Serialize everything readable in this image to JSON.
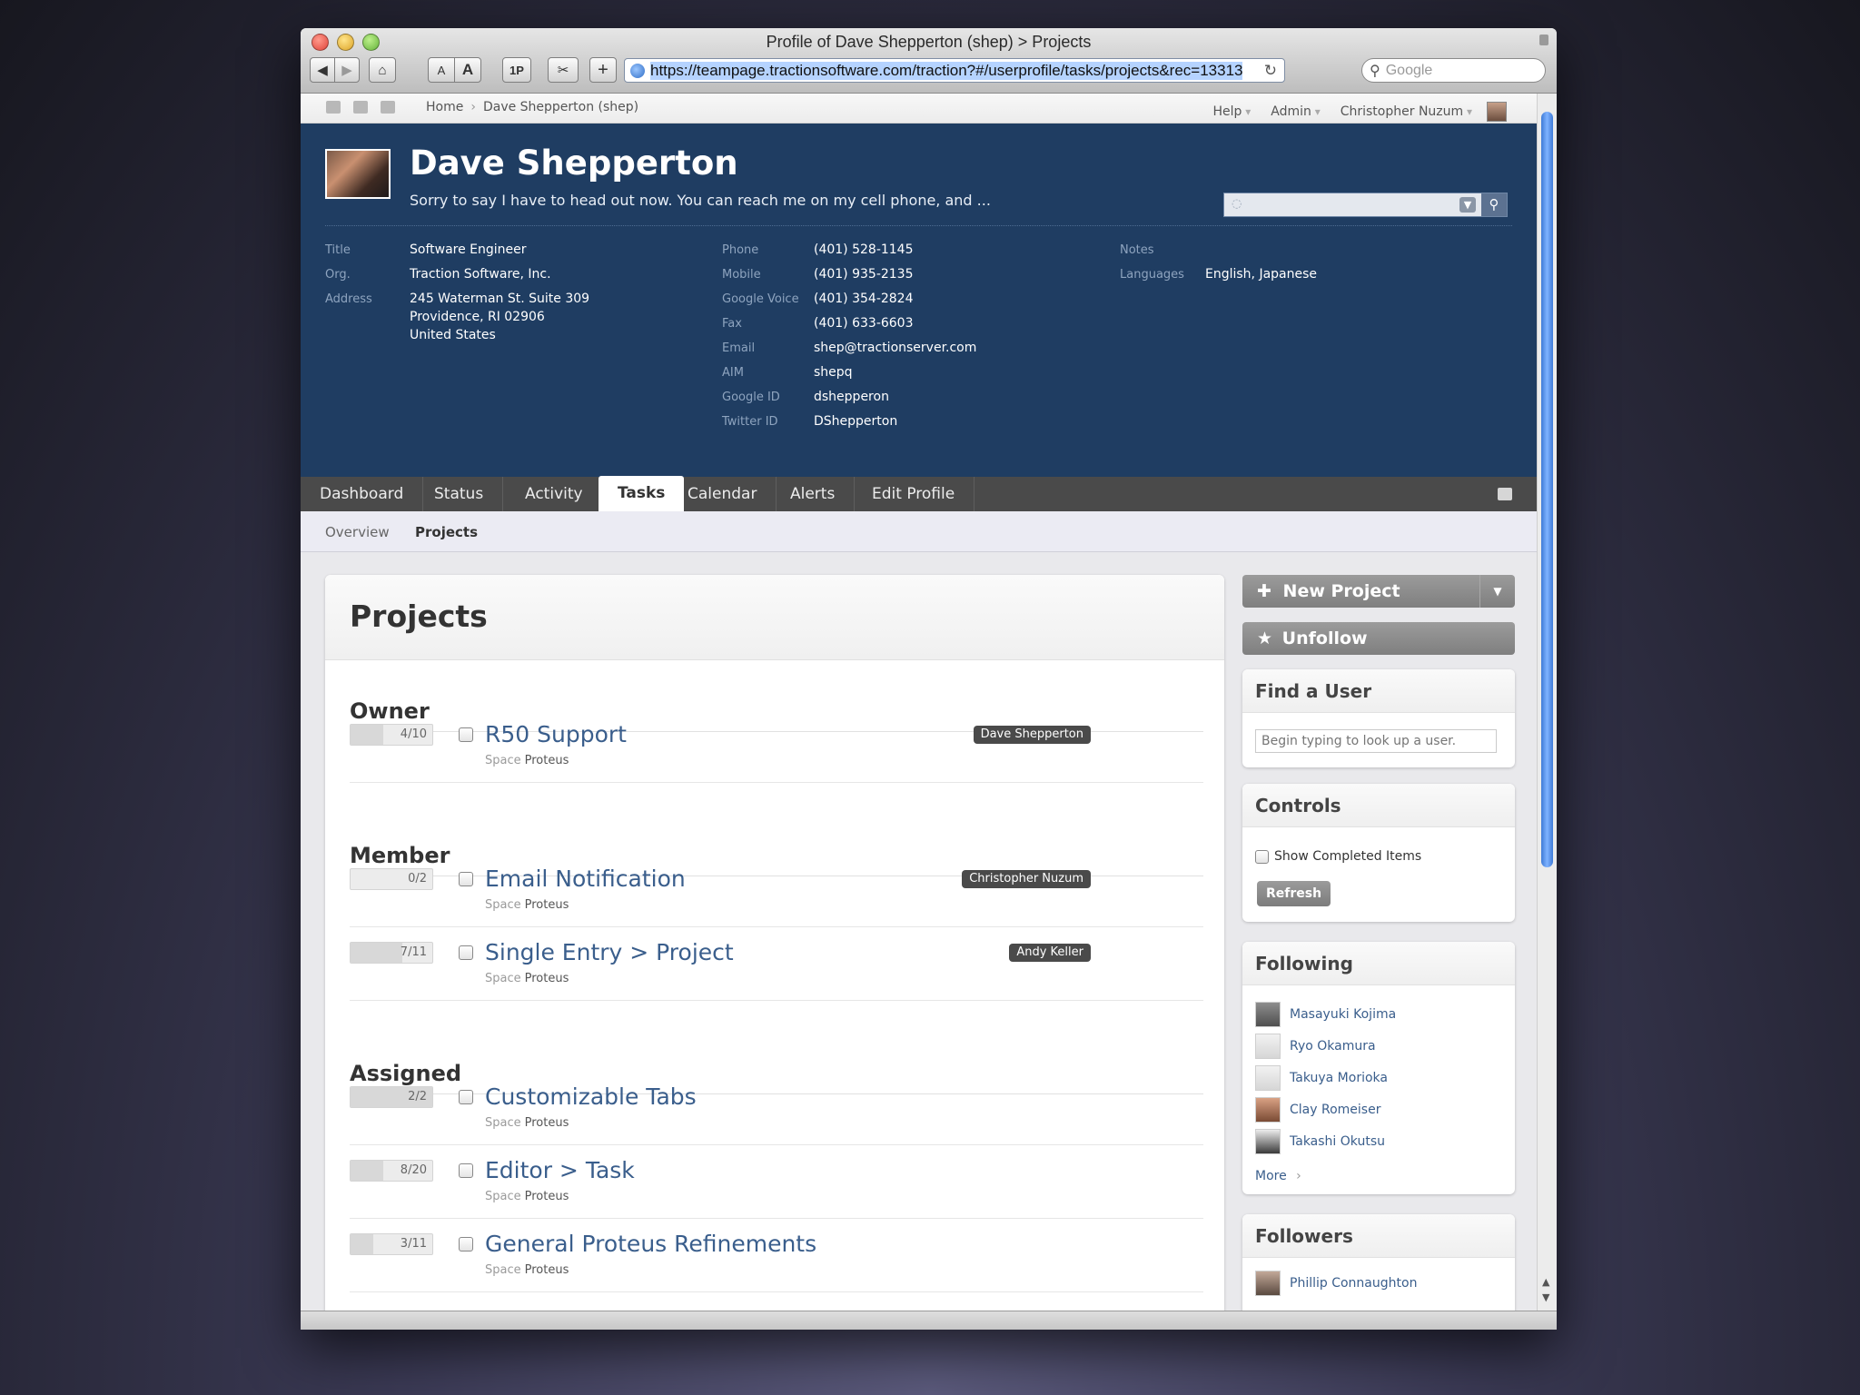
{
  "window": {
    "title": "Profile of Dave Shepperton (shep) > Projects"
  },
  "toolbar": {
    "url": "https://teampage.tractionsoftware.com/traction?#/userprofile/tasks/projects&rec=13313",
    "search_placeholder": "Google",
    "text_smaller": "A",
    "text_bigger": "A",
    "onepass": "1P",
    "add": "+"
  },
  "topnav": {
    "breadcrumb": [
      "Home",
      "Dave Shepperton (shep)"
    ],
    "help": "Help",
    "admin": "Admin",
    "user": "Christopher Nuzum"
  },
  "profile": {
    "name": "Dave Shepperton",
    "status": "Sorry to say I have to head out now. You can reach me on my cell phone, and ...",
    "col1": [
      {
        "label": "Title",
        "value": "Software Engineer"
      },
      {
        "label": "Org.",
        "value": "Traction Software, Inc."
      },
      {
        "label": "Address",
        "value": "245 Waterman St. Suite 309\nProvidence, RI 02906\nUnited States"
      }
    ],
    "col2": [
      {
        "label": "Phone",
        "value": "(401) 528-1145"
      },
      {
        "label": "Mobile",
        "value": "(401) 935-2135"
      },
      {
        "label": "Google Voice",
        "value": "(401) 354-2824"
      },
      {
        "label": "Fax",
        "value": "(401) 633-6603"
      },
      {
        "label": "Email",
        "value": "shep@tractionserver.com"
      },
      {
        "label": "AIM",
        "value": "shepq"
      },
      {
        "label": "Google ID",
        "value": "dshepperon"
      },
      {
        "label": "Twitter ID",
        "value": "DShepperton"
      }
    ],
    "col3": [
      {
        "label": "Notes",
        "value": ""
      },
      {
        "label": "Languages",
        "value": "English, Japanese"
      }
    ]
  },
  "tabs": [
    "Dashboard",
    "Status",
    "Activity",
    "Tasks",
    "Calendar",
    "Alerts",
    "Edit Profile"
  ],
  "active_tab": "Tasks",
  "subtabs": [
    "Overview",
    "Projects"
  ],
  "main": {
    "title": "Projects",
    "sections": [
      {
        "heading": "Owner",
        "items": [
          {
            "progress": "4/10",
            "fraction": 0.4,
            "title": "R50 Support",
            "space_label": "Space",
            "space": "Proteus",
            "owner": "Dave Shepperton"
          }
        ]
      },
      {
        "heading": "Member",
        "items": [
          {
            "progress": "0/2",
            "fraction": 0,
            "title": "Email Notification",
            "space_label": "Space",
            "space": "Proteus",
            "owner": "Christopher Nuzum"
          },
          {
            "progress": "7/11",
            "fraction": 0.636,
            "title": "Single Entry > Project",
            "space_label": "Space",
            "space": "Proteus",
            "owner": "Andy Keller"
          }
        ]
      },
      {
        "heading": "Assigned",
        "items": [
          {
            "progress": "2/2",
            "fraction": 1,
            "title": "Customizable Tabs",
            "space_label": "Space",
            "space": "Proteus",
            "owner": ""
          },
          {
            "progress": "8/20",
            "fraction": 0.4,
            "title": "Editor > Task",
            "space_label": "Space",
            "space": "Proteus",
            "owner": ""
          },
          {
            "progress": "3/11",
            "fraction": 0.273,
            "title": "General Proteus Refinements",
            "space_label": "Space",
            "space": "Proteus",
            "owner": ""
          }
        ]
      }
    ]
  },
  "sidebar": {
    "new_project": "New Project",
    "unfollow": "Unfollow",
    "find_user": {
      "title": "Find a User",
      "placeholder": "Begin typing to look up a user."
    },
    "controls": {
      "title": "Controls",
      "show_completed": "Show Completed Items",
      "refresh": "Refresh"
    },
    "following": {
      "title": "Following",
      "users": [
        "Masayuki Kojima",
        "Ryo Okamura",
        "Takuya Morioka",
        "Clay Romeiser",
        "Takashi Okutsu"
      ],
      "more": "More"
    },
    "followers": {
      "title": "Followers",
      "users": [
        "Phillip Connaughton"
      ]
    }
  }
}
